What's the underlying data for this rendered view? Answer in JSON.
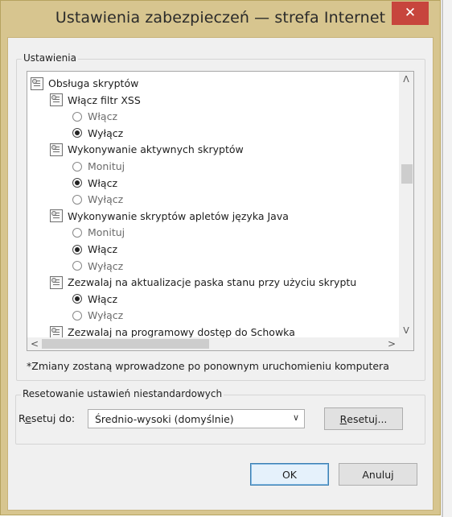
{
  "window": {
    "title": "Ustawienia zabezpieczeń — strefa Internet",
    "close_glyph": "✕"
  },
  "settings_group": {
    "legend": "Ustawienia",
    "tree": [
      {
        "kind": "category",
        "label": "Obsługa skryptów",
        "icon": "settings-icon"
      },
      {
        "kind": "setting",
        "label": "Włącz filtr XSS",
        "icon": "settings-icon"
      },
      {
        "kind": "option",
        "label": "Włącz",
        "checked": false
      },
      {
        "kind": "option",
        "label": "Wyłącz",
        "checked": true
      },
      {
        "kind": "setting",
        "label": "Wykonywanie aktywnych skryptów",
        "icon": "settings-icon"
      },
      {
        "kind": "option",
        "label": "Monituj",
        "checked": false
      },
      {
        "kind": "option",
        "label": "Włącz",
        "checked": true
      },
      {
        "kind": "option",
        "label": "Wyłącz",
        "checked": false
      },
      {
        "kind": "setting",
        "label": "Wykonywanie skryptów apletów języka Java",
        "icon": "settings-icon"
      },
      {
        "kind": "option",
        "label": "Monituj",
        "checked": false
      },
      {
        "kind": "option",
        "label": "Włącz",
        "checked": true
      },
      {
        "kind": "option",
        "label": "Wyłącz",
        "checked": false
      },
      {
        "kind": "setting",
        "label": "Zezwalaj na aktualizacje paska stanu przy użyciu skryptu",
        "icon": "settings-icon"
      },
      {
        "kind": "option",
        "label": "Włącz",
        "checked": true
      },
      {
        "kind": "option",
        "label": "Wyłącz",
        "checked": false
      },
      {
        "kind": "setting",
        "label": "Zezwalaj na programowy dostęp do Schowka",
        "icon": "settings-icon"
      }
    ],
    "scroll": {
      "up": "ᐱ",
      "down": "ᐯ",
      "left": "<",
      "right": ">"
    },
    "note": "*Zmiany zostaną wprowadzone po ponownym uruchomieniu komputera"
  },
  "reset_group": {
    "legend": "Resetowanie ustawień niestandardowych",
    "reset_to_label_prefix": "R",
    "reset_to_label_underlined": "e",
    "reset_to_label_rest": "setuj do:",
    "selected_level": "Średnio-wysoki (domyślnie)",
    "dropdown_arrow": "∨",
    "reset_button_underlined": "R",
    "reset_button_rest": "esetuj..."
  },
  "buttons": {
    "ok": "OK",
    "cancel": "Anuluj"
  }
}
